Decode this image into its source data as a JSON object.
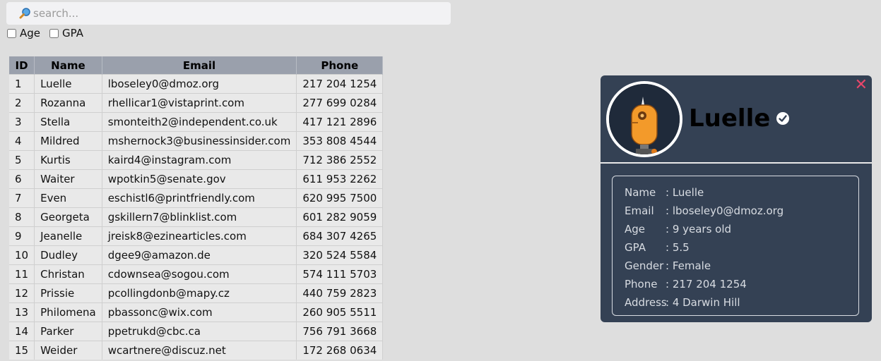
{
  "search": {
    "placeholder": "search..."
  },
  "filters": [
    {
      "label": "Age"
    },
    {
      "label": "GPA"
    }
  ],
  "table": {
    "headers": [
      "ID",
      "Name",
      "Email",
      "Phone"
    ],
    "rows": [
      [
        "1",
        "Luelle",
        "lboseley0@dmoz.org",
        "217 204 1254"
      ],
      [
        "2",
        "Rozanna",
        "rhellicar1@vistaprint.com",
        "277 699 0284"
      ],
      [
        "3",
        "Stella",
        "smonteith2@independent.co.uk",
        "417 121 2896"
      ],
      [
        "4",
        "Mildred",
        "mshernock3@businessinsider.com",
        "353 808 4544"
      ],
      [
        "5",
        "Kurtis",
        "kaird4@instagram.com",
        "712 386 2552"
      ],
      [
        "6",
        "Waiter",
        "wpotkin5@senate.gov",
        "611 953 2262"
      ],
      [
        "7",
        "Even",
        "eschistl6@printfriendly.com",
        "620 995 7500"
      ],
      [
        "8",
        "Georgeta",
        "gskillern7@blinklist.com",
        "601 282 9059"
      ],
      [
        "9",
        "Jeanelle",
        "jreisk8@ezinearticles.com",
        "684 307 4265"
      ],
      [
        "10",
        "Dudley",
        "dgee9@amazon.de",
        "320 524 5584"
      ],
      [
        "11",
        "Christan",
        "cdownsea@sogou.com",
        "574 111 5703"
      ],
      [
        "12",
        "Prissie",
        "pcollingdonb@mapy.cz",
        "440 759 2823"
      ],
      [
        "13",
        "Philomena",
        "pbassonc@wix.com",
        "260 905 5511"
      ],
      [
        "14",
        "Parker",
        "ppetrukd@cbc.ca",
        "756 791 3668"
      ],
      [
        "15",
        "Weider",
        "wcartnere@discuz.net",
        "172 268 0634"
      ]
    ]
  },
  "card": {
    "name": "Luelle",
    "close_icon": "✕",
    "details": [
      {
        "label": "Name",
        "value": ": Luelle"
      },
      {
        "label": "Email",
        "value": ": lboseley0@dmoz.org"
      },
      {
        "label": "Age",
        "value": ": 9 years old"
      },
      {
        "label": "GPA",
        "value": ": 5.5"
      },
      {
        "label": "Gender",
        "value": ": Female"
      },
      {
        "label": "Phone",
        "value": ": 217 204 1254"
      },
      {
        "label": "Address",
        "value": ": 4 Darwin Hill"
      }
    ]
  },
  "colors": {
    "close": "#e8466a",
    "card_bg": "#344154",
    "header_bg": "#9aa0ac"
  }
}
